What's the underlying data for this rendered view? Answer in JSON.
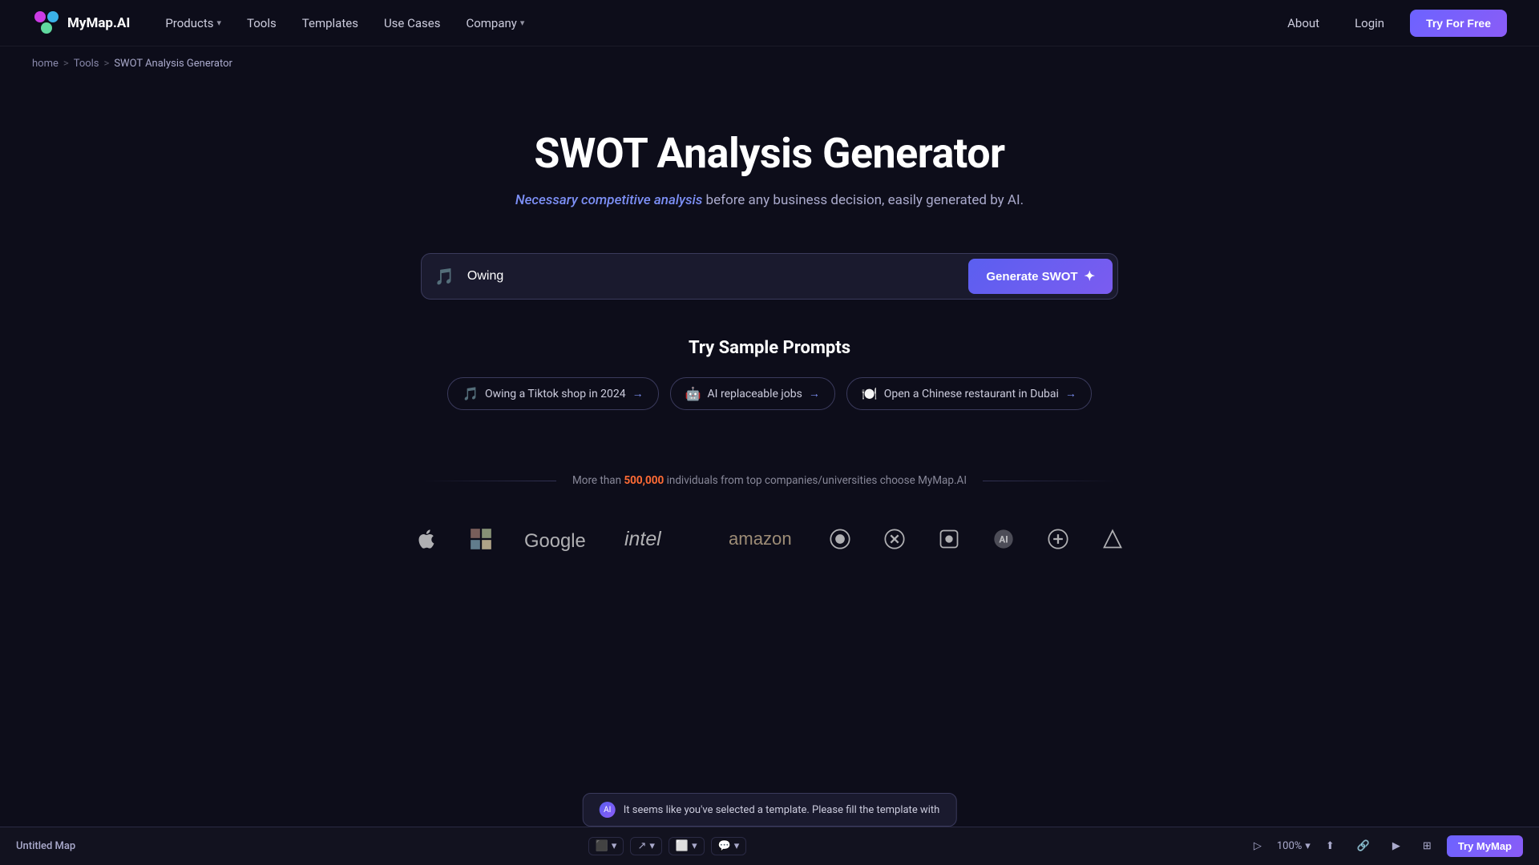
{
  "brand": {
    "name": "MyMap.AI",
    "logo_alt": "MyMap AI logo"
  },
  "navbar": {
    "products_label": "Products",
    "tools_label": "Tools",
    "templates_label": "Templates",
    "use_cases_label": "Use Cases",
    "company_label": "Company",
    "about_label": "About",
    "login_label": "Login",
    "try_free_label": "Try For Free"
  },
  "breadcrumb": {
    "home": "home",
    "tools": "Tools",
    "current": "SWOT Analysis Generator"
  },
  "hero": {
    "title": "SWOT Analysis Generator",
    "subtitle_highlight": "Necessary competitive analysis",
    "subtitle_rest": " before any business decision, easily generated by AI.",
    "input_placeholder": "Owing",
    "generate_label": "Generate SWOT"
  },
  "sample_prompts": {
    "title": "Try Sample Prompts",
    "prompts": [
      {
        "icon": "🎵",
        "text": "Owing a Tiktok shop in 2024",
        "arrow": "→"
      },
      {
        "icon": "🤖",
        "text": "AI replaceable jobs",
        "arrow": "→"
      },
      {
        "icon": "🍽️",
        "text": "Open a Chinese restaurant in Dubai",
        "arrow": "→"
      }
    ]
  },
  "social_proof": {
    "text_before": "More than ",
    "count": "500,000",
    "text_after": " individuals from top companies/universities choose MyMap.AI"
  },
  "brands": [
    {
      "name": "Apple",
      "type": "apple"
    },
    {
      "name": "Microsoft",
      "type": "microsoft"
    },
    {
      "name": "Google",
      "type": "google"
    },
    {
      "name": "Intel",
      "type": "intel"
    },
    {
      "name": "Amazon",
      "type": "amazon"
    },
    {
      "name": "Circle1",
      "type": "circle"
    },
    {
      "name": "Circle2",
      "type": "circle2"
    },
    {
      "name": "Circle3",
      "type": "circle3"
    },
    {
      "name": "Circle4",
      "type": "circle4"
    },
    {
      "name": "Circle5",
      "type": "circle5"
    },
    {
      "name": "Circle6",
      "type": "circle6"
    }
  ],
  "bottom_bar": {
    "title": "Untitled Map",
    "zoom": "100%",
    "try_mymap": "Try MyMap"
  },
  "notification": {
    "text": "It seems like you've selected a template. Please fill the template with"
  }
}
